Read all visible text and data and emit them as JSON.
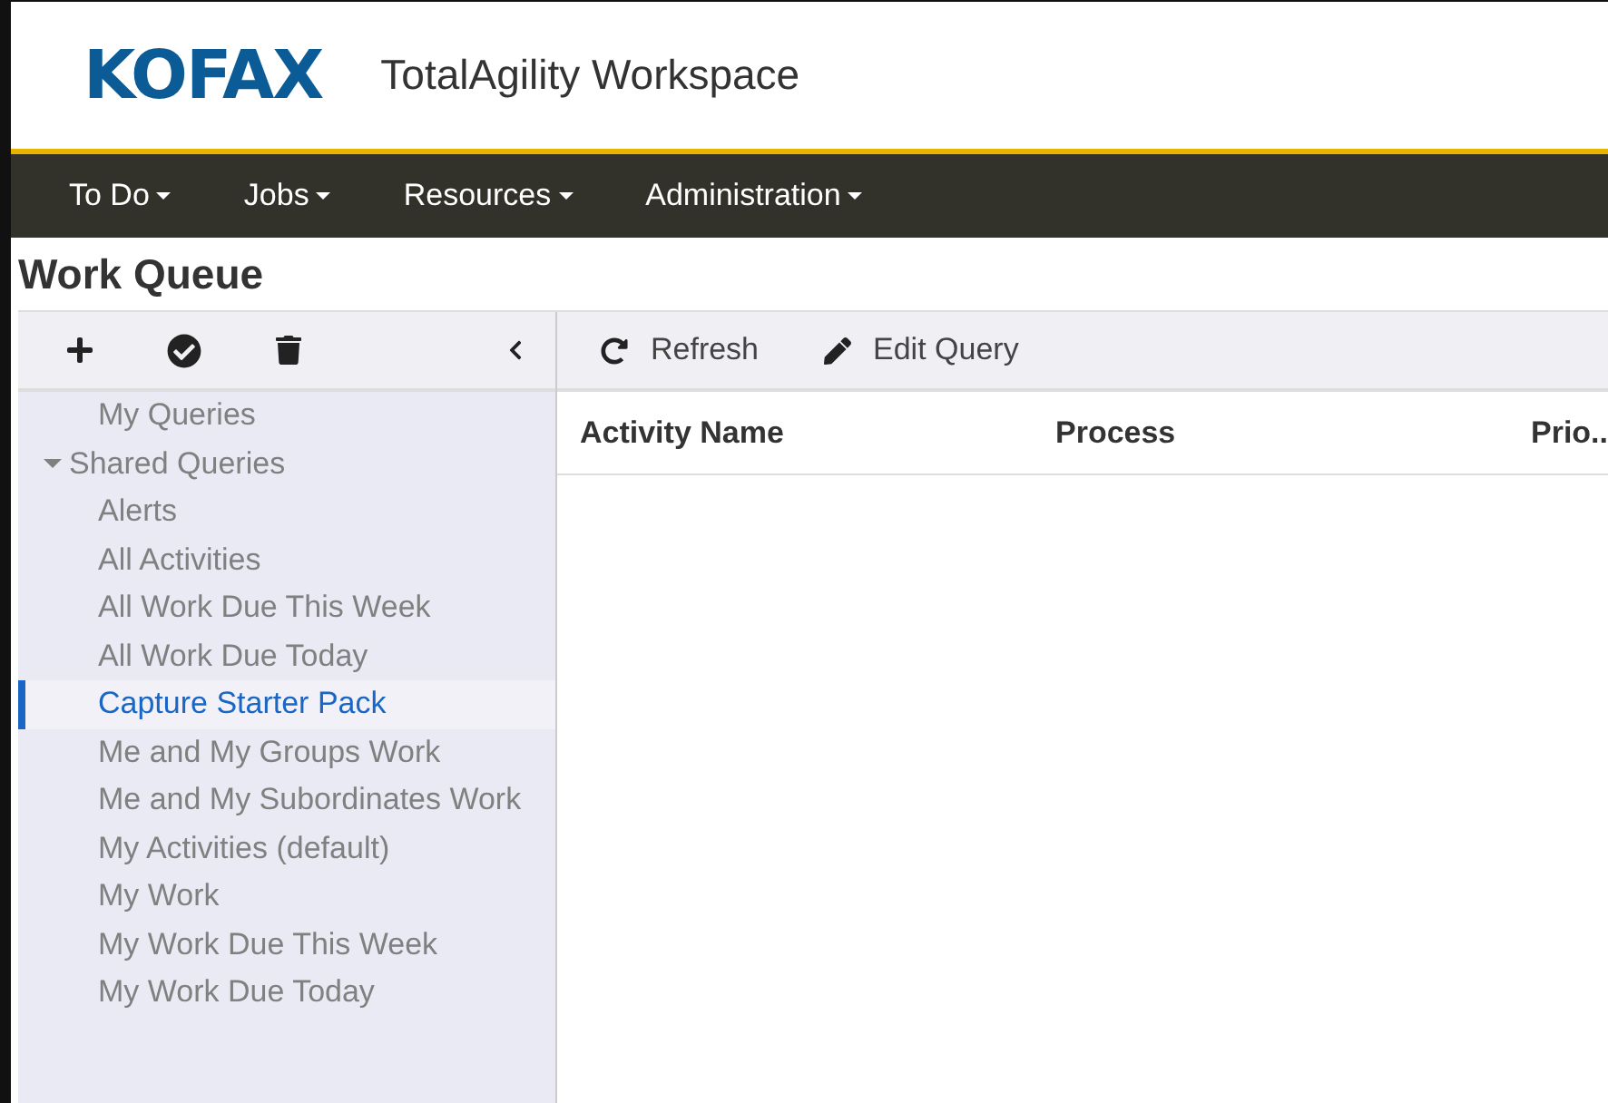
{
  "header": {
    "logo": "KOFAX",
    "title": "TotalAgility Workspace"
  },
  "nav": [
    {
      "label": "To Do"
    },
    {
      "label": "Jobs"
    },
    {
      "label": "Resources"
    },
    {
      "label": "Administration"
    }
  ],
  "page_title": "Work Queue",
  "sidebar": {
    "items": [
      {
        "label": "My Queries",
        "selected": false
      },
      {
        "label": "Shared Queries",
        "selected": false,
        "expanded": true,
        "children": [
          {
            "label": "Alerts",
            "selected": false
          },
          {
            "label": "All Activities",
            "selected": false
          },
          {
            "label": "All Work Due This Week",
            "selected": false
          },
          {
            "label": "All Work Due Today",
            "selected": false
          },
          {
            "label": "Capture Starter Pack",
            "selected": true
          },
          {
            "label": "Me and My Groups Work",
            "selected": false
          },
          {
            "label": "Me and My Subordinates Work",
            "selected": false
          },
          {
            "label": "My Activities (default)",
            "selected": false
          },
          {
            "label": "My Work",
            "selected": false
          },
          {
            "label": "My Work Due This Week",
            "selected": false
          },
          {
            "label": "My Work Due Today",
            "selected": false
          }
        ]
      }
    ]
  },
  "toolbar": [
    {
      "label": "Refresh",
      "kind": "refresh"
    },
    {
      "label": "Edit Query",
      "kind": "edit"
    }
  ],
  "table": {
    "columns": [
      "Activity Name",
      "Process",
      "Prio.."
    ]
  }
}
